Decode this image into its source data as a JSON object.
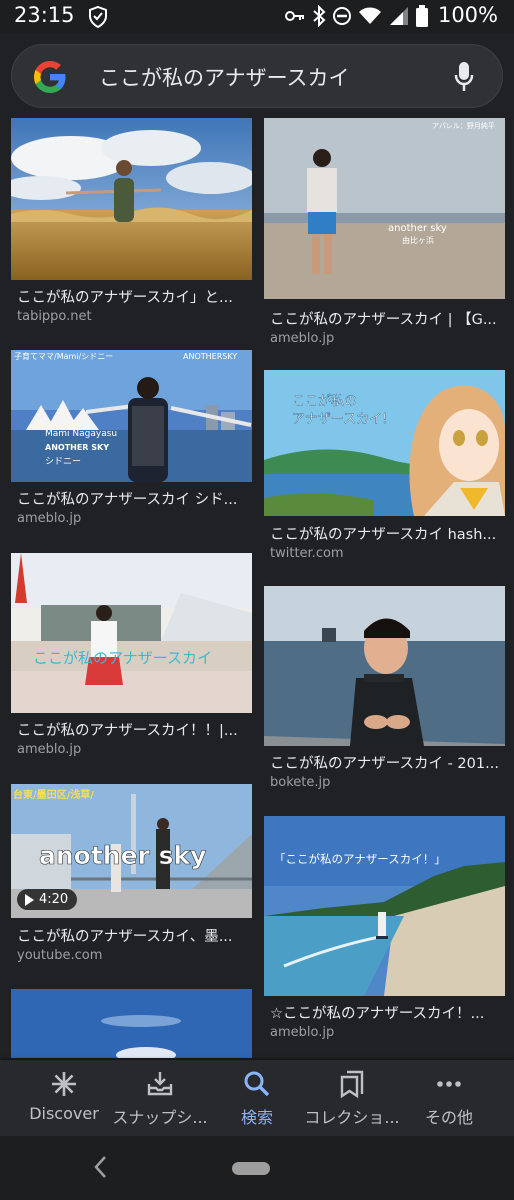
{
  "status_bar": {
    "time": "23:15",
    "battery": "100%",
    "icons": [
      "shield-icon",
      "key-icon",
      "bluetooth-icon",
      "dnd-icon",
      "wifi-icon",
      "signal-icon",
      "battery-icon"
    ]
  },
  "search": {
    "query": "ここが私のアナザースカイ",
    "logo": "google-g-logo",
    "mic": "mic-icon"
  },
  "results": {
    "left": [
      {
        "title": "ここが私のアナザースカイ」と...",
        "source": "tabippo.net"
      },
      {
        "title": "ここが私のアナザースカイ シド...",
        "source": "ameblo.jp",
        "overlay": {
          "top_left": "子育てママ/Mami/シドニー",
          "top_right": "ANOTHERSKY",
          "name": "Mami Nagayasu",
          "tag": "ANOTHER SKY",
          "place": "シドニー"
        }
      },
      {
        "title": "ここが私のアナザースカイ！！|...",
        "source": "ameblo.jp",
        "overlay": {
          "caption": "ここが私のアナザースカイ"
        }
      },
      {
        "title": "ここが私のアナザースカイ、墨...",
        "source": "youtube.com",
        "duration": "4:20",
        "overlay": {
          "caption": "another sky",
          "tag": "台東/墨田区/浅草/"
        }
      },
      {
        "title": "",
        "source": ""
      }
    ],
    "right": [
      {
        "title": "ここが私のアナザースカイ | 【G...",
        "source": "ameblo.jp",
        "overlay": {
          "top": "アパレル：野月純平",
          "caption": "another sky",
          "place": "由比ヶ浜"
        }
      },
      {
        "title": "ここが私のアナザースカイ hash...",
        "source": "twitter.com",
        "overlay": {
          "caption_l1": "ここが私の",
          "caption_l2": "アナザースカイ!"
        }
      },
      {
        "title": "ここが私のアナザースカイ - 201...",
        "source": "bokete.jp"
      },
      {
        "title": "☆ここが私のアナザースカイ！...",
        "source": "ameblo.jp",
        "overlay": {
          "caption": "「ここが私のアナザースカイ！」"
        }
      }
    ]
  },
  "bottom_nav": [
    {
      "label": "Discover",
      "icon": "asterisk-icon",
      "active": false
    },
    {
      "label": "スナップシ...",
      "icon": "snapshot-inbox-icon",
      "active": false
    },
    {
      "label": "検索",
      "icon": "search-icon",
      "active": true
    },
    {
      "label": "コレクショ...",
      "icon": "bookmark-stack-icon",
      "active": false
    },
    {
      "label": "その他",
      "icon": "more-dots-icon",
      "active": false
    }
  ],
  "colors": {
    "background": "#202124",
    "search_bar": "#303134",
    "active_accent": "#8ab4f8",
    "source_text": "#9aa0a6"
  }
}
